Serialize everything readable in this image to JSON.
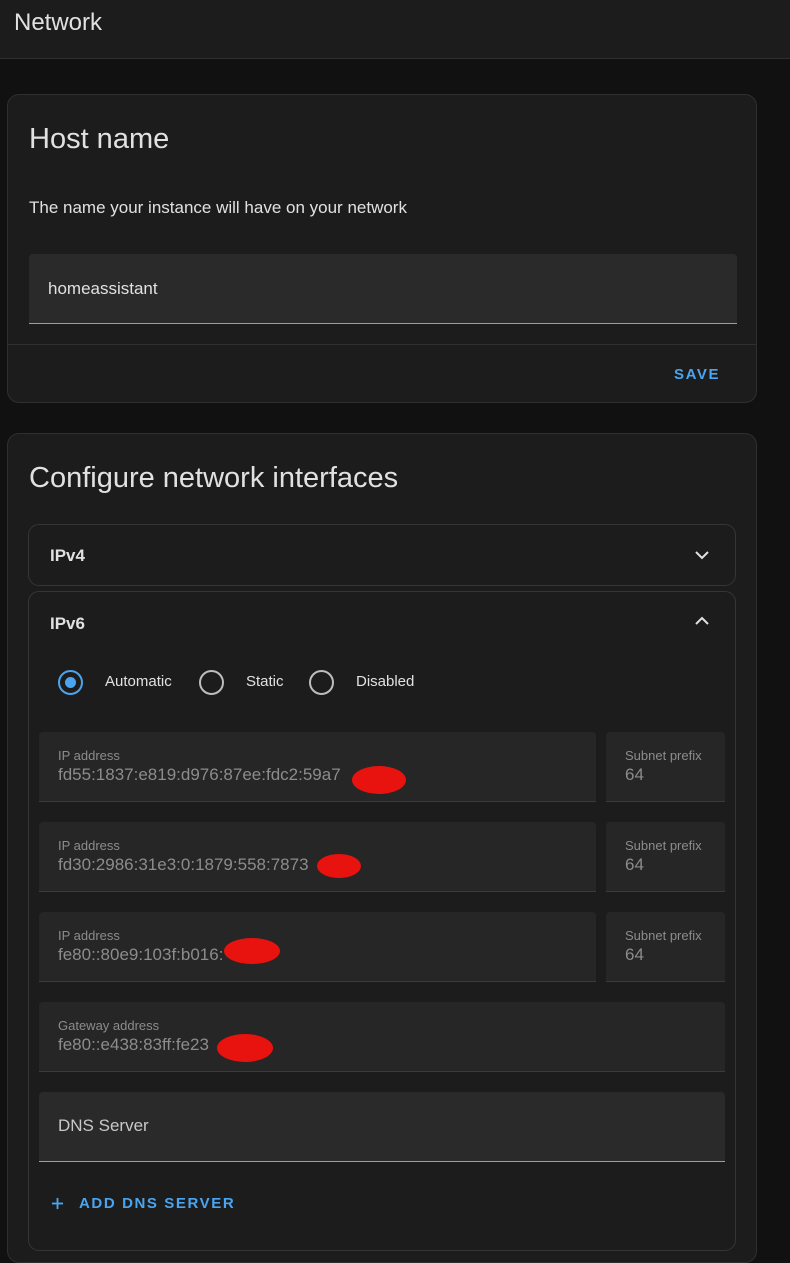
{
  "header": {
    "title": "Network"
  },
  "hostname_card": {
    "title": "Host name",
    "description": "The name your instance will have on your network",
    "hostname_value": "homeassistant",
    "save_label": "SAVE"
  },
  "interfaces_card": {
    "title": "Configure network interfaces",
    "ipv4": {
      "label": "IPv4",
      "expanded": false,
      "chevron_icon": "chevron-down-icon"
    },
    "ipv6": {
      "label": "IPv6",
      "expanded": true,
      "chevron_icon": "chevron-up-icon",
      "modes": [
        {
          "label": "Automatic",
          "selected": true
        },
        {
          "label": "Static",
          "selected": false
        },
        {
          "label": "Disabled",
          "selected": false
        }
      ],
      "addresses": [
        {
          "ip_label": "IP address",
          "ip_value": "fd55:1837:e819:d976:87ee:fdc2:59a7",
          "prefix_label": "Subnet prefix",
          "prefix_value": "64"
        },
        {
          "ip_label": "IP address",
          "ip_value": "fd30:2986:31e3:0:1879:558:7873",
          "prefix_label": "Subnet prefix",
          "prefix_value": "64"
        },
        {
          "ip_label": "IP address",
          "ip_value": "fe80::80e9:103f:b016:",
          "prefix_label": "Subnet prefix",
          "prefix_value": "64"
        }
      ],
      "gateway": {
        "label": "Gateway address",
        "value": "fe80::e438:83ff:fe23"
      },
      "dns": {
        "placeholder": "DNS Server"
      },
      "add_dns_label": "ADD DNS SERVER"
    }
  },
  "colors": {
    "accent": "#4aa5f0",
    "background": "#111111",
    "card": "#1c1c1c",
    "redaction": "#e8120e"
  }
}
